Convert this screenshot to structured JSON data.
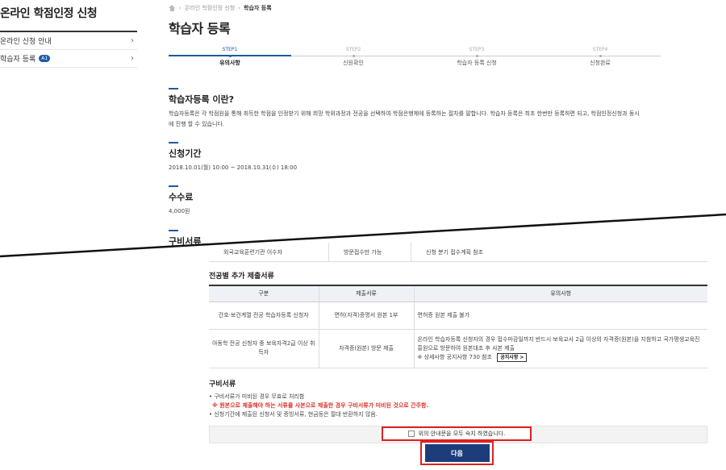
{
  "sidebar": {
    "title": "온라인 학점인정 신청",
    "items": [
      {
        "label": "온라인 신청 안내",
        "badge": ""
      },
      {
        "label": "학습자 등록",
        "badge": "A1"
      }
    ]
  },
  "breadcrumb": {
    "parent": "온라인 학점인정 신청",
    "current": "학습자 등록"
  },
  "page_title": "학습자 등록",
  "steps": [
    {
      "num": "STEP1",
      "name": "유의사항",
      "active": true
    },
    {
      "num": "STEP2",
      "name": "신원확인",
      "active": false
    },
    {
      "num": "STEP3",
      "name": "학습자 등록 신청",
      "active": false
    },
    {
      "num": "STEP4",
      "name": "신청완료",
      "active": false
    }
  ],
  "sections": {
    "about": {
      "title": "학습자등록 이란?",
      "text": "학습자등록은 각 학점원을 통해 취득한 학점을 인정받기 위해 희망 학위과정과 전공을 선택하여 학점은행제에 등록하는 절차를 말합니다. 학습자 등록은 최초 한번만 등록하면 되고, 학점인정신청과 동시에 진행 할 수 있습니다."
    },
    "period": {
      "title": "신청기간",
      "text": "2018.10.01(월) 10:00 ~ 2018.10.31(수) 18:00"
    },
    "fee": {
      "title": "수수료",
      "text": "4,000원"
    },
    "docs": {
      "title": "구비서류"
    }
  },
  "top_row": {
    "c1": "외국교육훈련기관 이수자",
    "c2": "방문접수만 가능",
    "c3": "신청 분기 접수계획 참조"
  },
  "major_docs": {
    "title": "전공별 추가 제출서류",
    "headers": [
      "구분",
      "제출서류",
      "유의사항"
    ],
    "rows": [
      {
        "category": "간호·보건계열 전공 학습자등록 신청자",
        "document": "면허(자격)증명서 원본 1부",
        "note": "면허증 원본 제출 불가",
        "button": ""
      },
      {
        "category": "아동학 전공 신청자 중 보육자격2급 이상 취득자",
        "document": "자격증(원본) 방문 제출",
        "note": "온라인 학습자등록 신청자의 경우 접수마감일까지 반드시 보육교사 2급 이상의 자격증(원본)을 지참하고 국가평생교육진흥원으로 방문하여 원본대조 후 사본 제출",
        "sub_note": "※ 상세사항 공지사항 730 참조",
        "button": "공지사항 >"
      }
    ]
  },
  "docs_notes": {
    "title": "구비서류",
    "items": [
      {
        "text": "구비서류가 미비된 경우 무효로 처리함",
        "type": "bullet"
      },
      {
        "text": "※ 원본으로 제출해야 하는 서류를 사본으로 제출한 경우 구비서류가 미비된 것으로 간주함.",
        "type": "warn"
      },
      {
        "text": "신청기간에 제출된 신청서 및 증빙서류, 현금등은 절대 반환하지 않음.",
        "type": "bullet"
      }
    ]
  },
  "agree_label": "위의 안내문을 모두 숙지 하였습니다.",
  "next_label": "다음",
  "colors": {
    "accent": "#1c5aa6",
    "button": "#1c3d7a",
    "highlight": "#e02020",
    "warn": "#d9342b"
  }
}
